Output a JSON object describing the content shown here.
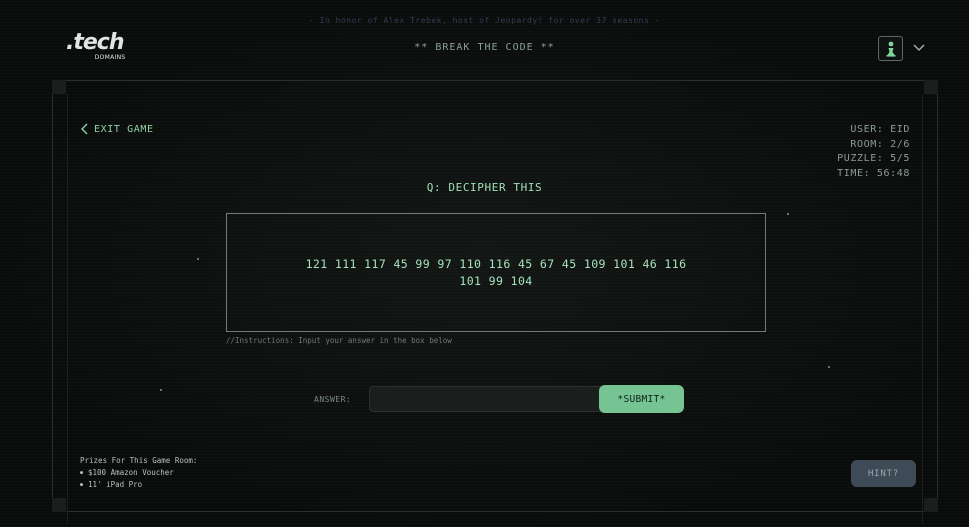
{
  "header": {
    "tribute": "- In honor of Alex Trebek, host of Jeopardy! for over 37 seasons -",
    "logo_word": ".tech",
    "logo_sub": "DOMAINS",
    "page_title": "** BREAK THE CODE **",
    "user_icon": "user-pawn-icon",
    "menu_icon": "chevron-down-icon"
  },
  "nav": {
    "exit_label": "EXIT GAME",
    "exit_icon": "chevron-left-icon"
  },
  "stats": {
    "user": "USER: EID",
    "room": "ROOM: 2/6",
    "puzzle": "PUZZLE: 5/5",
    "time": "TIME: 56:48"
  },
  "puzzle": {
    "question": "Q: DECIPHER THIS",
    "code": "121 111 117 45 99 97 110 116 45 67 45 109 101 46 116 101 99 104",
    "instructions": "//Instructions: Input your answer in the box below"
  },
  "answer": {
    "label": "ANSWER:",
    "value": "",
    "placeholder": "",
    "submit_label": "*SUBMIT*"
  },
  "prizes": {
    "heading": "Prizes For This Game Room:",
    "items": [
      "$100 Amazon Voucher",
      "11' iPad Pro"
    ]
  },
  "hint": {
    "label": "HINT?"
  },
  "colors": {
    "accent_green": "#76c493",
    "text_green": "#a5e4bb",
    "hint_bg": "#3e4a55",
    "background": "#0b0d0c"
  }
}
